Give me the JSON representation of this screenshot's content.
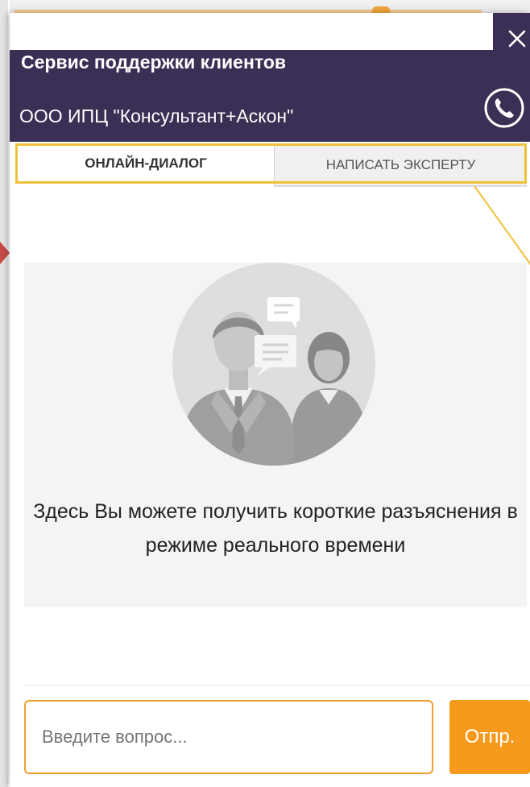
{
  "header": {
    "title": "Сервис поддержки клиентов",
    "subtitle": "ООО ИПЦ \"Консультант+Аскон\""
  },
  "tabs": [
    {
      "label": "ОНЛАЙН-ДИАЛОГ",
      "active": true
    },
    {
      "label": "НАПИСАТЬ ЭКСПЕРТУ",
      "active": false
    }
  ],
  "main": {
    "info_text": "Здесь Вы можете получить короткие разъяснения в режиме реального времени"
  },
  "composer": {
    "placeholder": "Введите вопрос...",
    "send_label": "Отпр."
  },
  "icons": {
    "close": "close-icon",
    "phone": "phone-icon",
    "illustration": "support-agents-illustration"
  },
  "colors": {
    "header_bg": "#3b2f55",
    "accent": "#f59a1c",
    "highlight": "#f0c039"
  }
}
